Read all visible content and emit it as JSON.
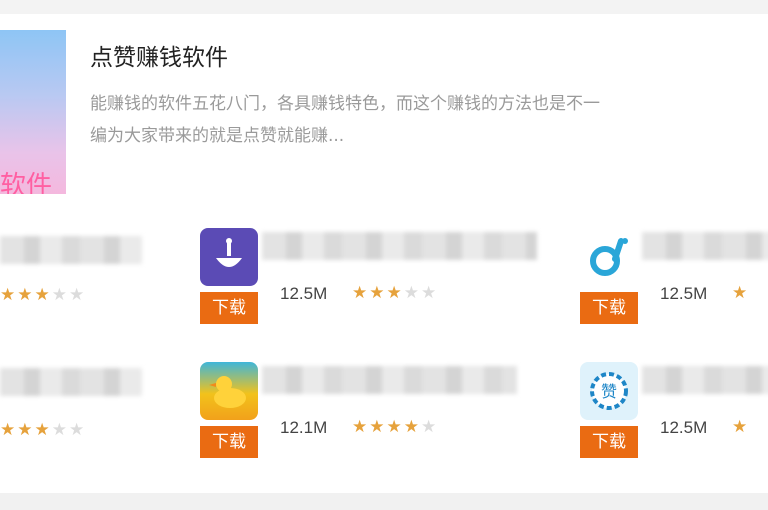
{
  "category": {
    "title": "点赞赚钱软件",
    "description_lines": [
      "能赚钱的软件五花八门，各具赚钱特色，而这个赚钱的方法也是不一",
      "编为大家带来的就是点赞就能赚..."
    ],
    "banner_text": "软件"
  },
  "apps": [
    {
      "size": "",
      "rating": 3,
      "download_label": ""
    },
    {
      "size": "12.5M",
      "rating": 3,
      "download_label": "下载",
      "icon": "rocket-app-icon",
      "icon_color": "#5b4bb5"
    },
    {
      "size": "12.5M",
      "rating": 1,
      "download_label": "下载",
      "icon": "d-logo-app-icon",
      "icon_color": "#2aa6d8"
    },
    {
      "size": "",
      "rating": 3,
      "download_label": ""
    },
    {
      "size": "12.1M",
      "rating": 4,
      "download_label": "下载",
      "icon": "duck-app-icon",
      "icon_color": "#f2c21b"
    },
    {
      "size": "12.5M",
      "rating": 1,
      "download_label": "下载",
      "icon": "zan-badge-app-icon",
      "icon_color": "#1e86c7"
    }
  ],
  "colors": {
    "download_button": "#ea6b12",
    "star_on": "#e6a23c",
    "star_off": "#dcdcdc"
  }
}
